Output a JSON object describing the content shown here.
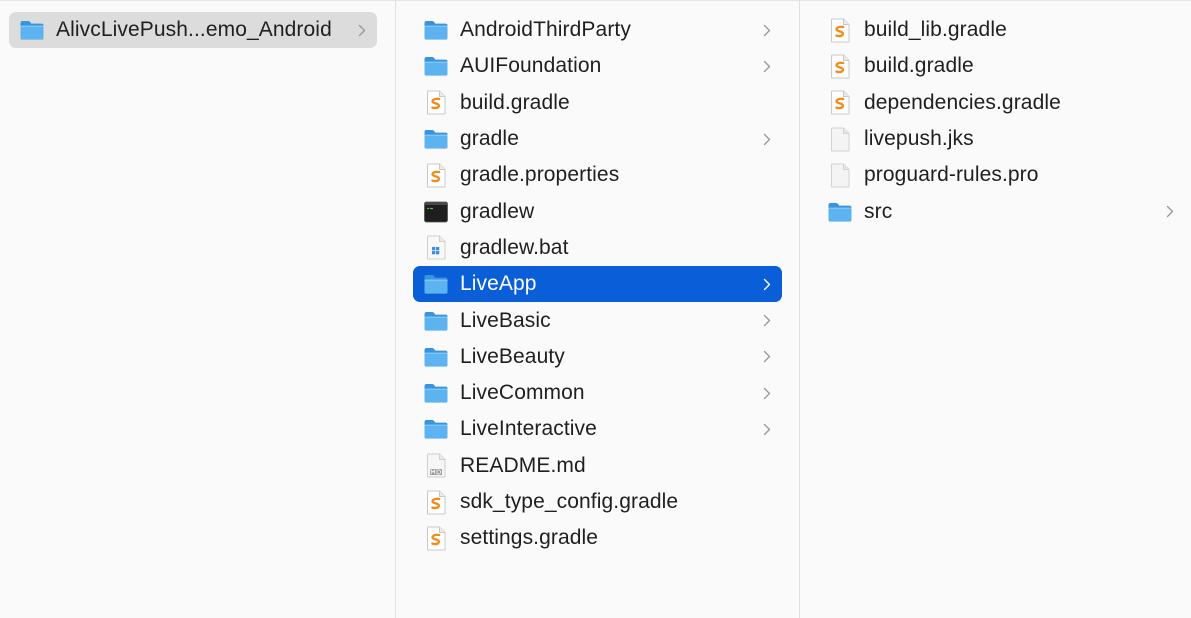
{
  "colors": {
    "selection": "#0a5fd9",
    "folder": "#4ea8ec",
    "gradle": "#f28a1c",
    "inactive_selection": "#dcdcdc"
  },
  "column1": {
    "items": [
      {
        "label": "AlivcLivePush...emo_Android",
        "icon": "folder-icon",
        "has_children": true,
        "state": "inactive-selected"
      }
    ]
  },
  "column2": {
    "items": [
      {
        "label": "AndroidThirdParty",
        "icon": "folder-icon",
        "has_children": true
      },
      {
        "label": "AUIFoundation",
        "icon": "folder-icon",
        "has_children": true
      },
      {
        "label": "build.gradle",
        "icon": "gradle-file-icon",
        "has_children": false
      },
      {
        "label": "gradle",
        "icon": "folder-icon",
        "has_children": true
      },
      {
        "label": "gradle.properties",
        "icon": "gradle-file-icon",
        "has_children": false
      },
      {
        "label": "gradlew",
        "icon": "terminal-executable-icon",
        "has_children": false
      },
      {
        "label": "gradlew.bat",
        "icon": "windows-batch-file-icon",
        "has_children": false
      },
      {
        "label": "LiveApp",
        "icon": "folder-icon",
        "has_children": true,
        "state": "selected"
      },
      {
        "label": "LiveBasic",
        "icon": "folder-icon",
        "has_children": true
      },
      {
        "label": "LiveBeauty",
        "icon": "folder-icon",
        "has_children": true
      },
      {
        "label": "LiveCommon",
        "icon": "folder-icon",
        "has_children": true
      },
      {
        "label": "LiveInteractive",
        "icon": "folder-icon",
        "has_children": true
      },
      {
        "label": "README.md",
        "icon": "markdown-file-icon",
        "has_children": false
      },
      {
        "label": "sdk_type_config.gradle",
        "icon": "gradle-file-icon",
        "has_children": false
      },
      {
        "label": "settings.gradle",
        "icon": "gradle-file-icon",
        "has_children": false
      }
    ]
  },
  "column3": {
    "items": [
      {
        "label": "build_lib.gradle",
        "icon": "gradle-file-icon",
        "has_children": false
      },
      {
        "label": "build.gradle",
        "icon": "gradle-file-icon",
        "has_children": false
      },
      {
        "label": "dependencies.gradle",
        "icon": "gradle-file-icon",
        "has_children": false
      },
      {
        "label": "livepush.jks",
        "icon": "blank-file-icon",
        "has_children": false
      },
      {
        "label": "proguard-rules.pro",
        "icon": "blank-file-icon",
        "has_children": false
      },
      {
        "label": "src",
        "icon": "folder-icon",
        "has_children": true
      }
    ]
  }
}
